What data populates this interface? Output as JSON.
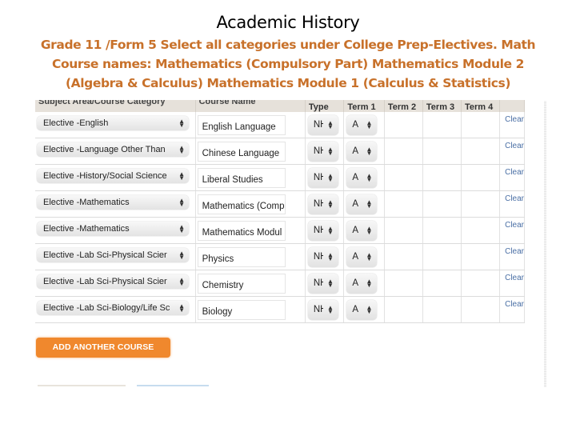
{
  "slide": {
    "title": "Academic History",
    "subtitle": "Grade 11 /Form 5 Select all categories under College Prep-Electives. Math Course names: Mathematics (Compulsory Part) Mathematics Module 2 (Algebra & Calculus) Mathematics Module 1 (Calculus & Statistics)",
    "accent_color": "#c8712a"
  },
  "table": {
    "headers": {
      "category": "Subject Area/Course Category",
      "course": "Course Name",
      "type": "Type",
      "term1": "Term 1",
      "term2": "Term 2",
      "term3": "Term 3",
      "term4": "Term 4"
    },
    "rows": [
      {
        "category": "Elective -English",
        "course": "English Language",
        "type": "NH",
        "term1": "A",
        "clear": "Clear"
      },
      {
        "category": "Elective -Language Other Than",
        "course": "Chinese Language",
        "type": "NH",
        "term1": "A",
        "clear": "Clear"
      },
      {
        "category": "Elective -History/Social Science",
        "course": "Liberal Studies",
        "type": "NH",
        "term1": "A",
        "clear": "Clear"
      },
      {
        "category": "Elective -Mathematics",
        "course": "Mathematics (Comp",
        "type": "NH",
        "term1": "A",
        "clear": "Clear"
      },
      {
        "category": "Elective -Mathematics",
        "course": "Mathematics Modul",
        "type": "NH",
        "term1": "A",
        "clear": "Clear"
      },
      {
        "category": "Elective -Lab Sci-Physical Scier",
        "course": "Physics",
        "type": "NH",
        "term1": "A",
        "clear": "Clear"
      },
      {
        "category": "Elective -Lab Sci-Physical Scier",
        "course": "Chemistry",
        "type": "NH",
        "term1": "A",
        "clear": "Clear"
      },
      {
        "category": "Elective -Lab Sci-Biology/Life Sc",
        "course": "Biology",
        "type": "NH",
        "term1": "A",
        "clear": "Clear"
      }
    ]
  },
  "actions": {
    "add_course_label": "ADD ANOTHER COURSE",
    "add_course_color": "#f0882d",
    "link_color": "#4a6fa5"
  },
  "icons": {
    "select_arrows": "updown-arrows-icon"
  }
}
